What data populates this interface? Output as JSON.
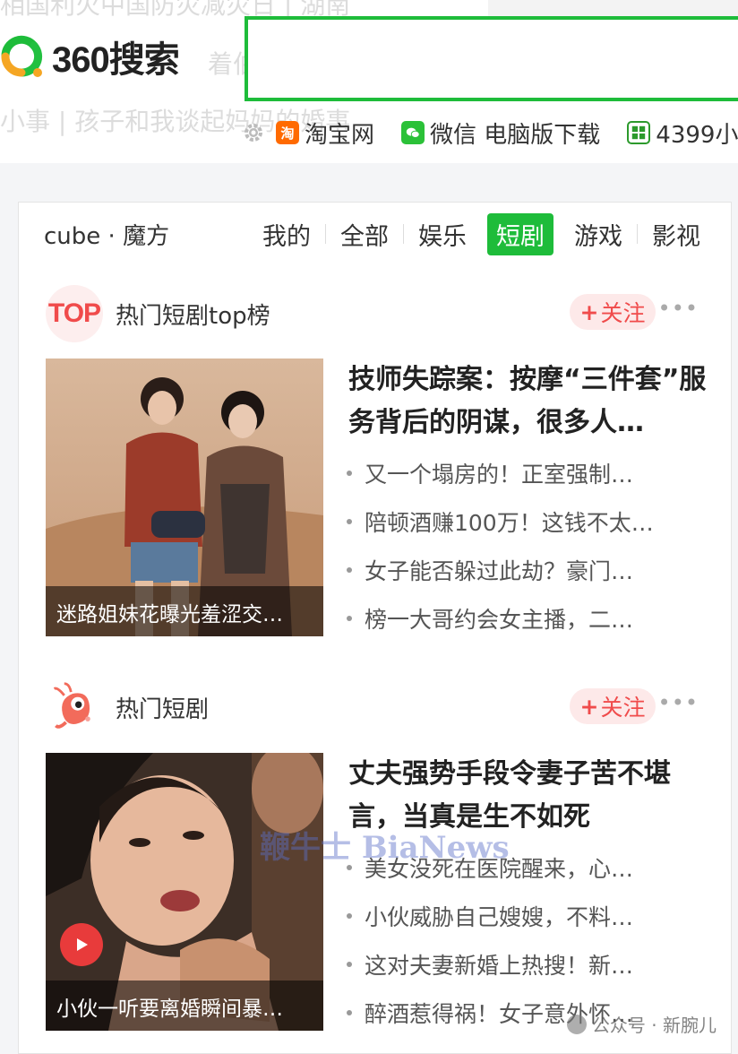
{
  "header": {
    "ghost_lines": [
      "相国利火中国防灾减灾日 | 湖南",
      "着伯",
      "小事 | 孩子和我谈起妈妈的婚事"
    ],
    "logo_text": "360搜索",
    "search": {
      "value": "",
      "placeholder": ""
    },
    "quick_links": [
      {
        "label": "淘宝网",
        "icon": "taobao-icon"
      },
      {
        "label": "微信 电脑版下载",
        "icon": "wechat-icon"
      },
      {
        "label": "4399小",
        "icon": "4399-icon"
      }
    ],
    "settings_icon": "gear-icon"
  },
  "cube": {
    "title": "cube · 魔方",
    "tabs": [
      "我的",
      "全部",
      "娱乐",
      "短剧",
      "游戏",
      "影视"
    ],
    "active_tab": "短剧",
    "accent": "#1ebc3a"
  },
  "feeds": [
    {
      "name": "热门短剧top榜",
      "avatar_text": "TOP",
      "follow_label": "关注",
      "more_label": "•••",
      "thumb_caption": "迷路姐妹花曝光羞涩交…",
      "headline": "技师失踪案：按摩“三件套”服务背后的阴谋，很多人…",
      "related": [
        "又一个塌房的！正室强制…",
        "陪顿酒赚100万！这钱不太…",
        "女子能否躲过此劫？豪门…",
        "榜一大哥约会女主播，二…"
      ]
    },
    {
      "name": "热门短剧",
      "avatar_icon": "shrimp-icon",
      "follow_label": "关注",
      "more_label": "•••",
      "thumb_caption": "小伙一听要离婚瞬间暴…",
      "headline": "丈夫强势手段令妻子苦不堪言，当真是生不如死",
      "related": [
        "美女没死在医院醒来，心…",
        "小伙威胁自己嫂嫂，不料…",
        "这对夫妻新婚上热搜！新…",
        "醉酒惹得祸！女子意外怀…"
      ]
    }
  ],
  "watermarks": {
    "bianews": "鞭牛士 BiaNews",
    "wechat": "公众号 · 新腕儿"
  },
  "colors": {
    "follow": "#f04b4b",
    "search_border": "#1ebc3a"
  }
}
